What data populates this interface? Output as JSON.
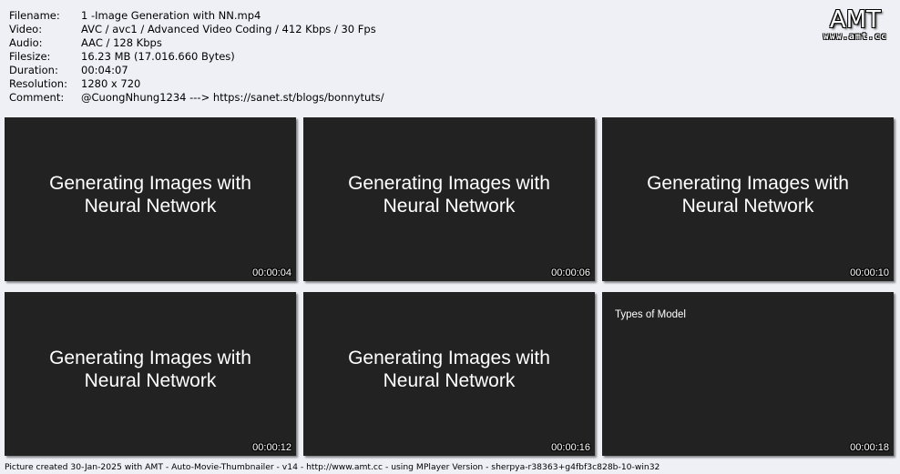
{
  "meta": [
    {
      "key": "Filename:",
      "value": "1 -Image Generation with NN.mp4"
    },
    {
      "key": "Video:",
      "value": "AVC / avc1 / Advanced Video Coding / 412 Kbps / 30 Fps"
    },
    {
      "key": "Audio:",
      "value": "AAC / 128 Kbps"
    },
    {
      "key": "Filesize:",
      "value": "16.23 MB (17.016.660 Bytes)"
    },
    {
      "key": "Duration:",
      "value": "00:04:07"
    },
    {
      "key": "Resolution:",
      "value": "1280 x 720"
    },
    {
      "key": "Comment:",
      "value": "@CuongNhung1234 ---> https://sanet.st/blogs/bonnytuts/"
    }
  ],
  "logo": {
    "big": "AMT",
    "small": "www.amt.cc"
  },
  "thumbnails": [
    {
      "title": "Generating Images with\nNeural Network",
      "time": "00:00:04"
    },
    {
      "title": "Generating Images with\nNeural Network",
      "time": "00:00:06"
    },
    {
      "title": "Generating Images with\nNeural Network",
      "time": "00:00:10"
    },
    {
      "title": "Generating Images with\nNeural Network",
      "time": "00:00:12"
    },
    {
      "title": "Generating Images with\nNeural Network",
      "time": "00:00:16"
    },
    {
      "small_title": "Types of Model",
      "time": "00:00:18"
    }
  ],
  "footer": "Picture created 30-Jan-2025 with AMT - Auto-Movie-Thumbnailer - v14 - http://www.amt.cc - using MPlayer Version - sherpya-r38363+g4fbf3c828b-10-win32",
  "colors": {
    "background": "#eef0f5",
    "thumbnail": "#232223"
  }
}
